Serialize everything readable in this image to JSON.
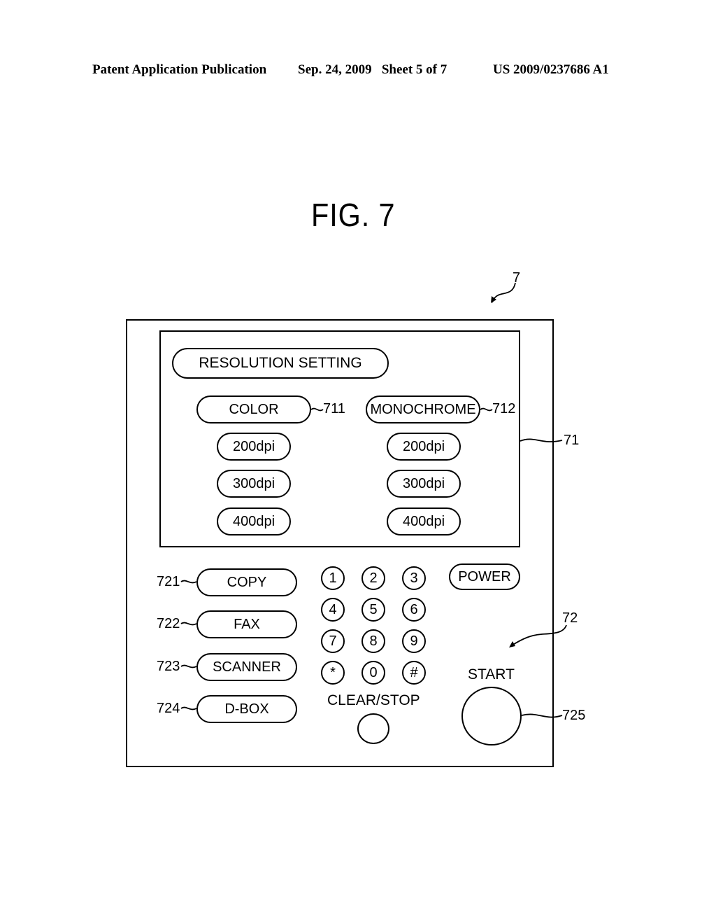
{
  "header": {
    "left": "Patent Application Publication",
    "date_sheet": "Sep. 24, 2009   Sheet 5 of 7",
    "number": "US 2009/0237686 A1"
  },
  "figure": {
    "title": "FIG. 7",
    "ref_device": "7",
    "ref_display": "71",
    "ref_panel": "72"
  },
  "display": {
    "heading": "RESOLUTION SETTING",
    "color": {
      "label": "COLOR",
      "ref": "711",
      "options": [
        "200dpi",
        "300dpi",
        "400dpi"
      ]
    },
    "monochrome": {
      "label": "MONOCHROME",
      "ref": "712",
      "options": [
        "200dpi",
        "300dpi",
        "400dpi"
      ]
    }
  },
  "panel": {
    "function_buttons": [
      {
        "label": "COPY",
        "ref": "721"
      },
      {
        "label": "FAX",
        "ref": "722"
      },
      {
        "label": "SCANNER",
        "ref": "723"
      },
      {
        "label": "D-BOX",
        "ref": "724"
      }
    ],
    "keypad": [
      "1",
      "2",
      "3",
      "4",
      "5",
      "6",
      "7",
      "8",
      "9",
      "*",
      "0",
      "#"
    ],
    "power_label": "POWER",
    "clear_stop_label": "CLEAR/STOP",
    "start_label": "START",
    "start_ref": "725"
  }
}
